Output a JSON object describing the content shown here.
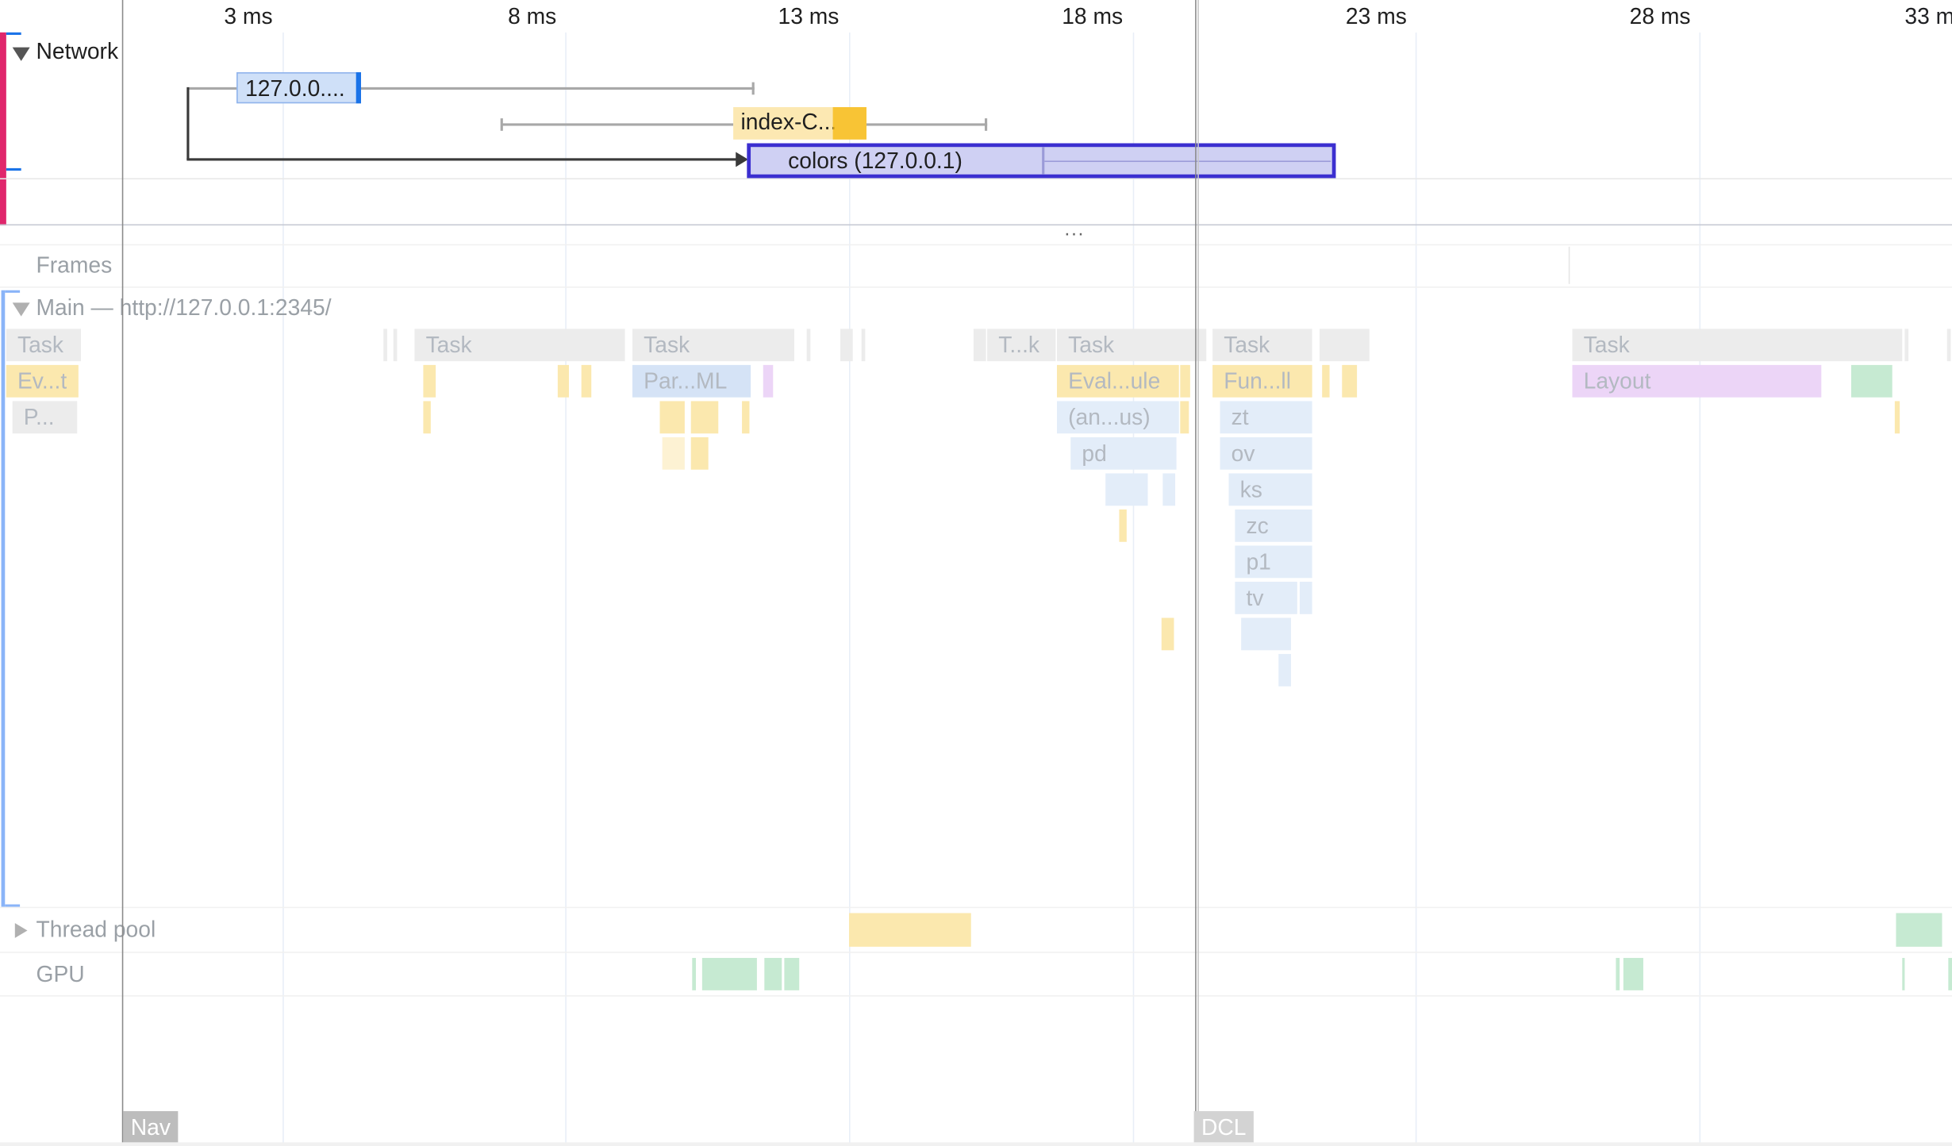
{
  "ruler": {
    "ticks": [
      "3 ms",
      "8 ms",
      "13 ms",
      "18 ms",
      "23 ms",
      "28 ms",
      "33 m"
    ]
  },
  "tracks": {
    "network": {
      "label": "Network",
      "requests": [
        {
          "label": "127.0.0...."
        },
        {
          "label": "index-C..."
        },
        {
          "label": "colors (127.0.0.1)",
          "selected": true
        }
      ]
    },
    "resize_handle": "...",
    "frames": {
      "label": "Frames"
    },
    "main": {
      "label": "Main — http://127.0.0.1:2345/",
      "tasks": [
        "Task",
        "Task",
        "Task",
        "T...k",
        "Task",
        "Task",
        "Task"
      ],
      "events": [
        "Ev...t",
        "P...",
        "Par...ML",
        "Eval...ule",
        "(an...us)",
        "pd",
        "Fun...ll",
        "zt",
        "ov",
        "ks",
        "zc",
        "p1",
        "tv",
        "Layout"
      ]
    },
    "thread_pool": {
      "label": "Thread pool"
    },
    "gpu": {
      "label": "GPU"
    }
  },
  "markers": {
    "nav": "Nav",
    "dcl": "DCL"
  },
  "colors": {
    "selected_outline": "#3b2fd0",
    "selected_fill": "#cfd0f3",
    "accent_left": "#e0266c",
    "task_gray": "#ececec",
    "scripting_yellow": "#fbe8ae",
    "loading_blue": "#e3edf9",
    "rendering_purple": "#ecd5f7",
    "painting_green": "#c6ead2"
  }
}
